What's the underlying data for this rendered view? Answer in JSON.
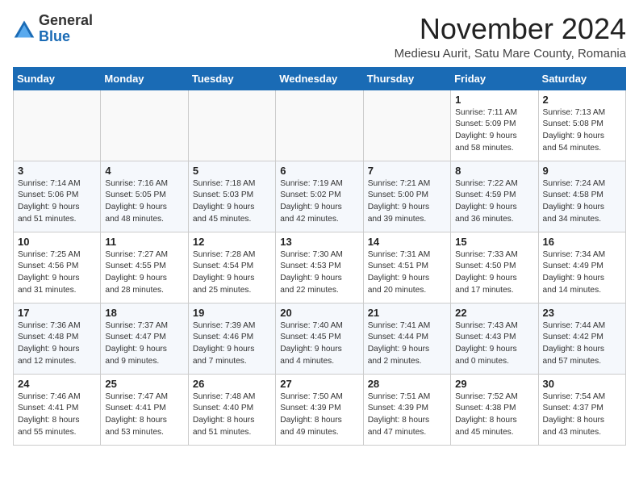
{
  "header": {
    "logo_line1": "General",
    "logo_line2": "Blue",
    "month_title": "November 2024",
    "location": "Mediesu Aurit, Satu Mare County, Romania"
  },
  "days_of_week": [
    "Sunday",
    "Monday",
    "Tuesday",
    "Wednesday",
    "Thursday",
    "Friday",
    "Saturday"
  ],
  "weeks": [
    [
      {
        "day": "",
        "info": ""
      },
      {
        "day": "",
        "info": ""
      },
      {
        "day": "",
        "info": ""
      },
      {
        "day": "",
        "info": ""
      },
      {
        "day": "",
        "info": ""
      },
      {
        "day": "1",
        "info": "Sunrise: 7:11 AM\nSunset: 5:09 PM\nDaylight: 9 hours\nand 58 minutes."
      },
      {
        "day": "2",
        "info": "Sunrise: 7:13 AM\nSunset: 5:08 PM\nDaylight: 9 hours\nand 54 minutes."
      }
    ],
    [
      {
        "day": "3",
        "info": "Sunrise: 7:14 AM\nSunset: 5:06 PM\nDaylight: 9 hours\nand 51 minutes."
      },
      {
        "day": "4",
        "info": "Sunrise: 7:16 AM\nSunset: 5:05 PM\nDaylight: 9 hours\nand 48 minutes."
      },
      {
        "day": "5",
        "info": "Sunrise: 7:18 AM\nSunset: 5:03 PM\nDaylight: 9 hours\nand 45 minutes."
      },
      {
        "day": "6",
        "info": "Sunrise: 7:19 AM\nSunset: 5:02 PM\nDaylight: 9 hours\nand 42 minutes."
      },
      {
        "day": "7",
        "info": "Sunrise: 7:21 AM\nSunset: 5:00 PM\nDaylight: 9 hours\nand 39 minutes."
      },
      {
        "day": "8",
        "info": "Sunrise: 7:22 AM\nSunset: 4:59 PM\nDaylight: 9 hours\nand 36 minutes."
      },
      {
        "day": "9",
        "info": "Sunrise: 7:24 AM\nSunset: 4:58 PM\nDaylight: 9 hours\nand 34 minutes."
      }
    ],
    [
      {
        "day": "10",
        "info": "Sunrise: 7:25 AM\nSunset: 4:56 PM\nDaylight: 9 hours\nand 31 minutes."
      },
      {
        "day": "11",
        "info": "Sunrise: 7:27 AM\nSunset: 4:55 PM\nDaylight: 9 hours\nand 28 minutes."
      },
      {
        "day": "12",
        "info": "Sunrise: 7:28 AM\nSunset: 4:54 PM\nDaylight: 9 hours\nand 25 minutes."
      },
      {
        "day": "13",
        "info": "Sunrise: 7:30 AM\nSunset: 4:53 PM\nDaylight: 9 hours\nand 22 minutes."
      },
      {
        "day": "14",
        "info": "Sunrise: 7:31 AM\nSunset: 4:51 PM\nDaylight: 9 hours\nand 20 minutes."
      },
      {
        "day": "15",
        "info": "Sunrise: 7:33 AM\nSunset: 4:50 PM\nDaylight: 9 hours\nand 17 minutes."
      },
      {
        "day": "16",
        "info": "Sunrise: 7:34 AM\nSunset: 4:49 PM\nDaylight: 9 hours\nand 14 minutes."
      }
    ],
    [
      {
        "day": "17",
        "info": "Sunrise: 7:36 AM\nSunset: 4:48 PM\nDaylight: 9 hours\nand 12 minutes."
      },
      {
        "day": "18",
        "info": "Sunrise: 7:37 AM\nSunset: 4:47 PM\nDaylight: 9 hours\nand 9 minutes."
      },
      {
        "day": "19",
        "info": "Sunrise: 7:39 AM\nSunset: 4:46 PM\nDaylight: 9 hours\nand 7 minutes."
      },
      {
        "day": "20",
        "info": "Sunrise: 7:40 AM\nSunset: 4:45 PM\nDaylight: 9 hours\nand 4 minutes."
      },
      {
        "day": "21",
        "info": "Sunrise: 7:41 AM\nSunset: 4:44 PM\nDaylight: 9 hours\nand 2 minutes."
      },
      {
        "day": "22",
        "info": "Sunrise: 7:43 AM\nSunset: 4:43 PM\nDaylight: 9 hours\nand 0 minutes."
      },
      {
        "day": "23",
        "info": "Sunrise: 7:44 AM\nSunset: 4:42 PM\nDaylight: 8 hours\nand 57 minutes."
      }
    ],
    [
      {
        "day": "24",
        "info": "Sunrise: 7:46 AM\nSunset: 4:41 PM\nDaylight: 8 hours\nand 55 minutes."
      },
      {
        "day": "25",
        "info": "Sunrise: 7:47 AM\nSunset: 4:41 PM\nDaylight: 8 hours\nand 53 minutes."
      },
      {
        "day": "26",
        "info": "Sunrise: 7:48 AM\nSunset: 4:40 PM\nDaylight: 8 hours\nand 51 minutes."
      },
      {
        "day": "27",
        "info": "Sunrise: 7:50 AM\nSunset: 4:39 PM\nDaylight: 8 hours\nand 49 minutes."
      },
      {
        "day": "28",
        "info": "Sunrise: 7:51 AM\nSunset: 4:39 PM\nDaylight: 8 hours\nand 47 minutes."
      },
      {
        "day": "29",
        "info": "Sunrise: 7:52 AM\nSunset: 4:38 PM\nDaylight: 8 hours\nand 45 minutes."
      },
      {
        "day": "30",
        "info": "Sunrise: 7:54 AM\nSunset: 4:37 PM\nDaylight: 8 hours\nand 43 minutes."
      }
    ]
  ]
}
